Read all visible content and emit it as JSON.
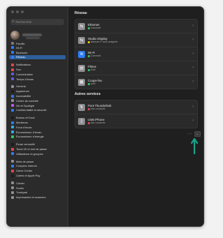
{
  "sidebar": {
    "search_placeholder": "Rechercher",
    "profile_caption": "Famille",
    "items": [
      {
        "label": "Wi-Fi",
        "icon": "wifi-icon",
        "color": "#2f7cf6"
      },
      {
        "label": "Bluetooth",
        "icon": "bluetooth-icon",
        "color": "#2f7cf6"
      },
      {
        "label": "Réseau",
        "icon": "globe-icon",
        "color": "#2f7cf6",
        "selected": true
      },
      {
        "sep": true
      },
      {
        "label": "Notifications",
        "icon": "bell-icon",
        "color": "#e5484d"
      },
      {
        "label": "Son",
        "icon": "speaker-icon",
        "color": "#e5484d"
      },
      {
        "label": "Concentration",
        "icon": "moon-icon",
        "color": "#5e5ce6"
      },
      {
        "label": "Temps d’écran",
        "icon": "hourglass-icon",
        "color": "#5e5ce6"
      },
      {
        "sep": true
      },
      {
        "label": "Général",
        "icon": "gear-icon",
        "color": "#8e8e93"
      },
      {
        "label": "Apparence",
        "icon": "appearance-icon",
        "color": "#1c1c1e"
      },
      {
        "label": "Accessibilité",
        "icon": "accessibility-icon",
        "color": "#2f7cf6"
      },
      {
        "label": "Centre de contrôle",
        "icon": "control-center-icon",
        "color": "#8e8e93"
      },
      {
        "label": "Siri et Spotlight",
        "icon": "siri-icon",
        "color": "#bf5af2"
      },
      {
        "label": "Confidentialité et sécurité",
        "icon": "hand-icon",
        "color": "#2f7cf6"
      },
      {
        "sep": true
      },
      {
        "label": "Bureau et Dock",
        "icon": "dock-icon",
        "color": "#1c1c1e"
      },
      {
        "label": "Moniteurs",
        "icon": "display-icon",
        "color": "#2f7cf6"
      },
      {
        "label": "Fond d’écran",
        "icon": "wallpaper-icon",
        "color": "#32ade6"
      },
      {
        "label": "Économiseur d’écran",
        "icon": "screensaver-icon",
        "color": "#32ade6"
      },
      {
        "label": "Économiseur d’énergie",
        "icon": "battery-icon",
        "color": "#34c759"
      },
      {
        "sep": true
      },
      {
        "label": "Écran verrouillé",
        "icon": "lock-icon",
        "color": "#1c1c1e"
      },
      {
        "label": "Touch ID et mot de passe",
        "icon": "fingerprint-icon",
        "color": "#e5484d"
      },
      {
        "label": "Utilisateurs et groupes",
        "icon": "users-icon",
        "color": "#2f7cf6"
      },
      {
        "sep": true
      },
      {
        "label": "Mots de passe",
        "icon": "key-icon",
        "color": "#8e8e93"
      },
      {
        "label": "Comptes Internet",
        "icon": "at-icon",
        "color": "#2f7cf6"
      },
      {
        "label": "Game Center",
        "icon": "gamecenter-icon",
        "color": "#e5484d"
      },
      {
        "label": "Cartes et Apple Pay",
        "icon": "wallet-icon",
        "color": "#1c1c1e"
      },
      {
        "sep": true
      },
      {
        "label": "Clavier",
        "icon": "keyboard-icon",
        "color": "#8e8e93"
      },
      {
        "label": "Souris",
        "icon": "mouse-icon",
        "color": "#8e8e93"
      },
      {
        "label": "Trackpad",
        "icon": "trackpad-icon",
        "color": "#8e8e93"
      },
      {
        "label": "Imprimantes et scanners",
        "icon": "printer-icon",
        "color": "#8e8e93"
      }
    ]
  },
  "network": {
    "title": "Réseau",
    "services": [
      {
        "name": "Ethernet",
        "status": "Connecté",
        "status_color": "#34c759",
        "icon": "ethernet-icon",
        "icon_color": "#8e8e93"
      },
      {
        "name": "Studio Display",
        "status": "Adresse IP auto-assignée",
        "status_color": "#ffcc00",
        "icon": "ethernet-icon",
        "icon_color": "#8e8e93"
      },
      {
        "name": "Wi-Fi",
        "status": "Connecté",
        "status_color": "#34c759",
        "icon": "wifi-icon",
        "icon_color": "#2f7cf6"
      },
      {
        "name": "Filtres",
        "status": "Actif",
        "status_color": "#34c759",
        "icon": "filter-icon",
        "icon_color": "#8e8e93"
      },
      {
        "name": "Coupe-feu",
        "status": "Actif",
        "status_color": "#34c759",
        "icon": "firewall-icon",
        "icon_color": "#8e8e93"
      }
    ]
  },
  "other": {
    "title": "Autres services",
    "services": [
      {
        "name": "Pont Thunderbolt",
        "status": "Non connecté",
        "status_color": "#e5484d",
        "icon": "thunderbolt-icon",
        "icon_color": "#8e8e93"
      },
      {
        "name": "USB iPhone",
        "status": "Non connecté",
        "status_color": "#e5484d",
        "icon": "phone-icon",
        "icon_color": "#8e8e93"
      }
    ]
  },
  "toolbar": {
    "more": "···",
    "menu": "⌄"
  },
  "help": "?",
  "annotation_color": "#1aa38a"
}
